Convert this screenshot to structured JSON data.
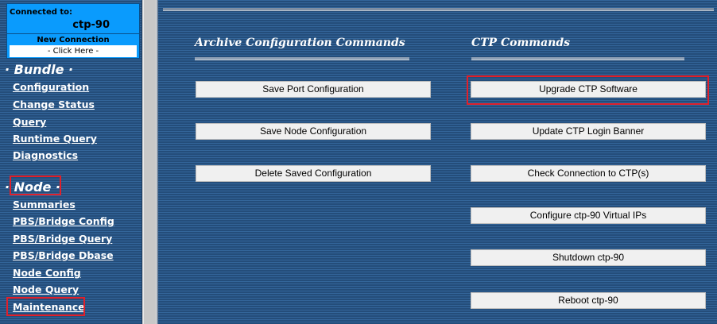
{
  "connection": {
    "label": "Connected to:",
    "host": "ctp-90",
    "new_label": "New Connection",
    "click_here": "- Click Here -"
  },
  "sidebar": {
    "bundle_header": "· Bundle ·",
    "bundle_items": [
      "Configuration",
      "Change Status",
      "Query",
      "Runtime Query",
      "Diagnostics"
    ],
    "node_header": "· Node ·",
    "node_items": [
      "Summaries",
      "PBS/Bridge Config",
      "PBS/Bridge Query",
      "PBS/Bridge Dbase",
      "Node Config",
      "Node Query",
      "Maintenance"
    ]
  },
  "archive": {
    "title": "Archive Configuration Commands",
    "buttons": [
      "Save Port Configuration",
      "Save Node Configuration",
      "Delete Saved Configuration"
    ]
  },
  "ctp": {
    "title": "CTP Commands",
    "buttons": [
      "Upgrade CTP Software",
      "Update CTP Login Banner",
      "Check Connection to CTP(s)",
      "Configure ctp-90 Virtual IPs",
      "Shutdown ctp-90",
      "Reboot ctp-90"
    ]
  },
  "colors": {
    "background": "#2c5a8c",
    "highlight": "#e0202a",
    "connection_box": "#0a9bfd"
  }
}
